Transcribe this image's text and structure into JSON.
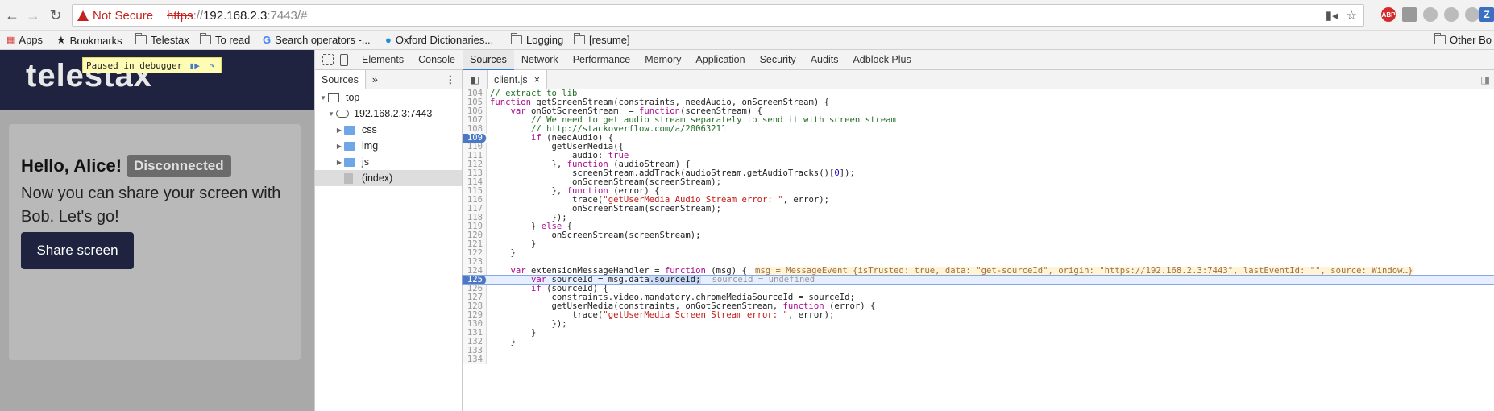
{
  "browser": {
    "security_label": "Not Secure",
    "url_scheme": "https",
    "url_sep": "://",
    "url_host": "192.168.2.3",
    "url_port": ":7443/#"
  },
  "bookmarks": {
    "items": [
      "Apps",
      "Bookmarks",
      "Telestax",
      "To read",
      "Search operators -...",
      "Oxford Dictionaries...",
      "Logging",
      "[resume]"
    ],
    "other": "Other Bo"
  },
  "webpage": {
    "logo": "telestax",
    "paused_label": "Paused in debugger",
    "greeting": "Hello, Alice!",
    "status": "Disconnected",
    "description": "Now you can share your screen with Bob. Let's go!",
    "share_button": "Share screen"
  },
  "devtools": {
    "tabs": [
      "Elements",
      "Console",
      "Sources",
      "Network",
      "Performance",
      "Memory",
      "Application",
      "Security",
      "Audits",
      "Adblock Plus"
    ],
    "navigator": {
      "tab": "Sources",
      "more": "»",
      "tree": [
        "top",
        "192.168.2.3:7443",
        "css",
        "img",
        "js",
        "(index)"
      ]
    },
    "file_tab": "client.js",
    "code": [
      {
        "n": "104",
        "t": "// extract to lib"
      },
      {
        "n": "105",
        "t": "function getScreenStream(constraints, needAudio, onScreenStream) {"
      },
      {
        "n": "106",
        "t": "    var onGotScreenStream  = function(screenStream) {"
      },
      {
        "n": "107",
        "t": "        // We need to get audio stream separately to send it with screen stream"
      },
      {
        "n": "108",
        "t": "        // http://stackoverflow.com/a/20063211"
      },
      {
        "n": "109",
        "t": "        if (needAudio) {"
      },
      {
        "n": "110",
        "t": "            getUserMedia({"
      },
      {
        "n": "111",
        "t": "                audio: true"
      },
      {
        "n": "112",
        "t": "            }, function (audioStream) {"
      },
      {
        "n": "113",
        "t": "                screenStream.addTrack(audioStream.getAudioTracks()[0]);"
      },
      {
        "n": "114",
        "t": "                onScreenStream(screenStream);"
      },
      {
        "n": "115",
        "t": "            }, function (error) {"
      },
      {
        "n": "116",
        "t": "                trace(\"getUserMedia Audio Stream error: \", error);"
      },
      {
        "n": "117",
        "t": "                onScreenStream(screenStream);"
      },
      {
        "n": "118",
        "t": "            });"
      },
      {
        "n": "119",
        "t": "        } else {"
      },
      {
        "n": "120",
        "t": "            onScreenStream(screenStream);"
      },
      {
        "n": "121",
        "t": "        }"
      },
      {
        "n": "122",
        "t": "    }"
      },
      {
        "n": "123",
        "t": ""
      },
      {
        "n": "124",
        "t": "    var extensionMessageHandler = function (msg) {"
      },
      {
        "n": "125",
        "t": "        var sourceId = msg.data.sourceId;"
      },
      {
        "n": "126",
        "t": "        if (sourceId) {"
      },
      {
        "n": "127",
        "t": "            constraints.video.mandatory.chromeMediaSourceId = sourceId;"
      },
      {
        "n": "128",
        "t": "            getUserMedia(constraints, onGotScreenStream, function (error) {"
      },
      {
        "n": "129",
        "t": "                trace(\"getUserMedia Screen Stream error: \", error);"
      },
      {
        "n": "130",
        "t": "            });"
      },
      {
        "n": "131",
        "t": "        }"
      },
      {
        "n": "132",
        "t": "    }"
      },
      {
        "n": "133",
        "t": ""
      },
      {
        "n": "134",
        "t": ""
      }
    ],
    "inline_124": "msg = MessageEvent {isTrusted: true, data: \"get-sourceId\", origin: \"https://192.168.2.3:7443\", lastEventId: \"\", source: Window…}",
    "inline_125": "sourceId = undefined"
  }
}
